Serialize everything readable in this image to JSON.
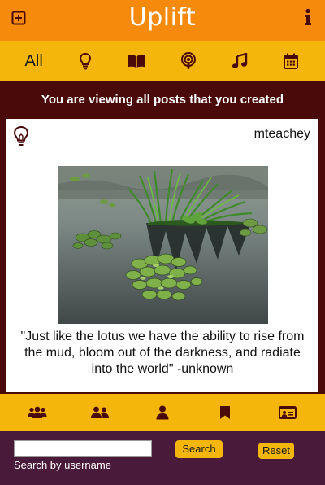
{
  "header": {
    "title": "Uplift",
    "add_icon": "plus-square-icon",
    "info_icon": "info-icon"
  },
  "filters": {
    "all_label": "All",
    "items": [
      "lightbulb-icon",
      "book-open-icon",
      "podcast-icon",
      "music-icon",
      "calendar-icon"
    ]
  },
  "banner": {
    "text": "You are viewing all posts that you created"
  },
  "post": {
    "type_icon": "lightbulb-icon",
    "author": "mteachey",
    "image_alt": "lotus pond photo",
    "quote": "\"Just like the lotus we have the ability to rise from the mud, bloom out of the darkness, and radiate into the world\" -unknown"
  },
  "tabs": [
    "community-icon",
    "friends-icon",
    "profile-icon",
    "bookmark-icon",
    "id-card-icon"
  ],
  "search": {
    "value": "",
    "placeholder": "",
    "caption": "Search by username",
    "search_label": "Search",
    "reset_label": "Reset"
  },
  "colors": {
    "header": "#f58a0c",
    "filterbar": "#f5b60c",
    "main_bg": "#4b0a0a",
    "search_bg": "#4a1a3a",
    "icon": "#4b0a0a"
  }
}
